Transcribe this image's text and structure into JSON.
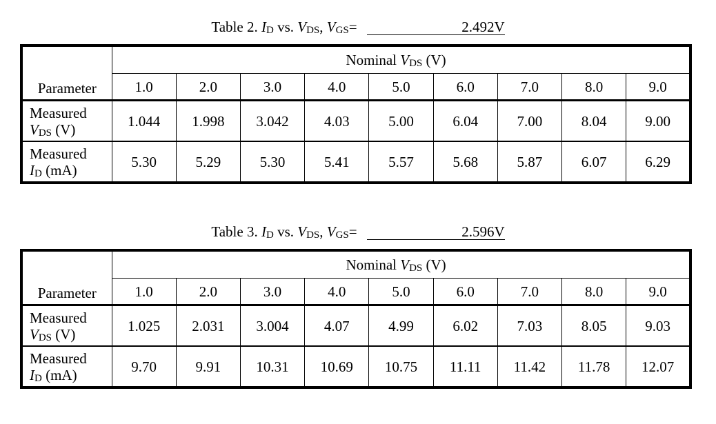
{
  "tables": [
    {
      "caption": {
        "prefix": "Table 2. ",
        "id_var": "I",
        "id_sub": "D",
        "vs": " vs. ",
        "vds_var": "V",
        "vds_sub": "DS",
        "sep": ", ",
        "vgs_var": "V",
        "vgs_sub": "GS",
        "eq": "=",
        "vgs_value": "2.492V"
      },
      "param_header": "Parameter",
      "group_header": {
        "text": "Nominal ",
        "var": "V",
        "sub": "DS",
        "unit": " (V)"
      },
      "nominal_vds": [
        "1.0",
        "2.0",
        "3.0",
        "4.0",
        "5.0",
        "6.0",
        "7.0",
        "8.0",
        "9.0"
      ],
      "rows": [
        {
          "label_line1": "Measured",
          "label_var": "V",
          "label_sub": "DS",
          "label_unit": " (V)",
          "values": [
            "1.044",
            "1.998",
            "3.042",
            "4.03",
            "5.00",
            "6.04",
            "7.00",
            "8.04",
            "9.00"
          ]
        },
        {
          "label_line1": "Measured",
          "label_var": "I",
          "label_sub": "D",
          "label_unit": " (mA)",
          "values": [
            "5.30",
            "5.29",
            "5.30",
            "5.41",
            "5.57",
            "5.68",
            "5.87",
            "6.07",
            "6.29"
          ]
        }
      ]
    },
    {
      "caption": {
        "prefix": "Table 3. ",
        "id_var": "I",
        "id_sub": "D",
        "vs": " vs. ",
        "vds_var": "V",
        "vds_sub": "DS",
        "sep": ", ",
        "vgs_var": "V",
        "vgs_sub": "GS",
        "eq": "=",
        "vgs_value": "2.596V"
      },
      "param_header": "Parameter",
      "group_header": {
        "text": "Nominal ",
        "var": "V",
        "sub": "DS",
        "unit": " (V)"
      },
      "nominal_vds": [
        "1.0",
        "2.0",
        "3.0",
        "4.0",
        "5.0",
        "6.0",
        "7.0",
        "8.0",
        "9.0"
      ],
      "rows": [
        {
          "label_line1": "Measured",
          "label_var": "V",
          "label_sub": "DS",
          "label_unit": " (V)",
          "values": [
            "1.025",
            "2.031",
            "3.004",
            "4.07",
            "4.99",
            "6.02",
            "7.03",
            "8.05",
            "9.03"
          ]
        },
        {
          "label_line1": "Measured",
          "label_var": "I",
          "label_sub": "D",
          "label_unit": " (mA)",
          "values": [
            "9.70",
            "9.91",
            "10.31",
            "10.69",
            "10.75",
            "11.11",
            "11.42",
            "11.78",
            "12.07"
          ]
        }
      ]
    }
  ]
}
